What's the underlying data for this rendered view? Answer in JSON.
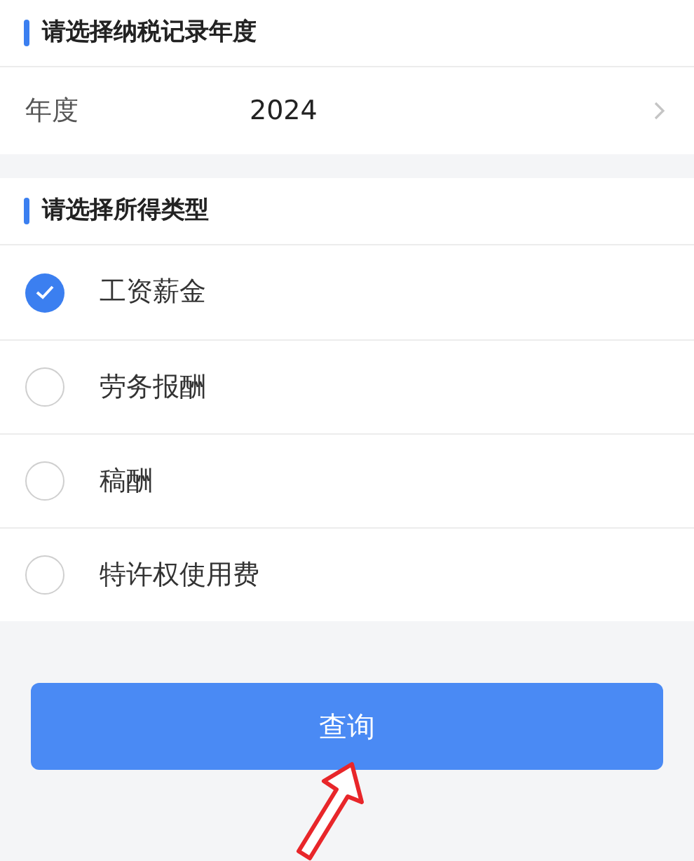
{
  "year_section": {
    "title": "请选择纳税记录年度",
    "field": {
      "label": "年度",
      "value": "2024"
    }
  },
  "income_section": {
    "title": "请选择所得类型",
    "options": [
      {
        "label": "工资薪金",
        "selected": true
      },
      {
        "label": "劳务报酬",
        "selected": false
      },
      {
        "label": "稿酬",
        "selected": false
      },
      {
        "label": "特许权使用费",
        "selected": false
      }
    ]
  },
  "query_button": {
    "label": "查询"
  }
}
